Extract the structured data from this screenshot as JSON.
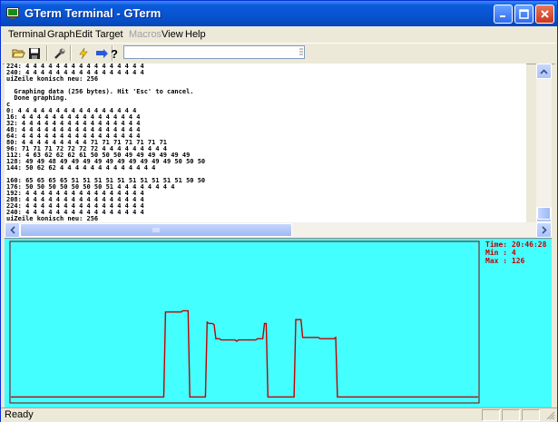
{
  "window": {
    "title": "GTerm Terminal - GTerm",
    "icon": "terminal-app-icon",
    "controls": [
      "minimize-icon",
      "maximize-icon",
      "close-icon"
    ]
  },
  "menu": [
    {
      "label": "Terminal",
      "enabled": true
    },
    {
      "label": "Graph",
      "enabled": true
    },
    {
      "label": "Edit",
      "enabled": true
    },
    {
      "label": "Target",
      "enabled": true
    },
    {
      "label": "Macros",
      "enabled": false
    },
    {
      "label": "View",
      "enabled": true
    },
    {
      "label": "Help",
      "enabled": true
    }
  ],
  "toolbar": {
    "buttons": [
      "open-folder-icon",
      "save-icon",
      "wrench-icon",
      "lightning-icon",
      "arrow-right-icon",
      "help-icon"
    ],
    "command_input": {
      "value": "",
      "placeholder": ""
    }
  },
  "terminal": {
    "lines": [
      "224: 4 4 4 4 4 4 4 4 4 4 4 4 4 4 4 4",
      "240: 4 4 4 4 4 4 4 4 4 4 4 4 4 4 4 4",
      "uiZeile konisch neu: 256",
      "",
      "  Graphing data (256 bytes). Hit 'Esc' to cancel.",
      "  Done graphing.",
      "c",
      "0: 4 4 4 4 4 4 4 4 4 4 4 4 4 4 4 4",
      "16: 4 4 4 4 4 4 4 4 4 4 4 4 4 4 4 4",
      "32: 4 4 4 4 4 4 4 4 4 4 4 4 4 4 4 4",
      "48: 4 4 4 4 4 4 4 4 4 4 4 4 4 4 4 4",
      "64: 4 4 4 4 4 4 4 4 4 4 4 4 4 4 4 4",
      "80: 4 4 4 4 4 4 4 4 4 71 71 71 71 71 71 71",
      "96: 71 71 71 72 72 72 72 4 4 4 4 4 4 4 4 4",
      "112: 4 63 62 62 62 61 50 50 50 49 49 49 49 49 49",
      "128: 49 49 48 49 49 49 49 49 49 49 49 49 49 50 50 50",
      "144: 50 62 62 4 4 4 4 4 4 4 4 4 4 4 4 4",
      "",
      "160: 65 65 65 65 51 51 51 51 51 51 51 51 51 51 50 50",
      "176: 50 50 50 50 50 50 50 51 4 4 4 4 4 4 4 4",
      "192: 4 4 4 4 4 4 4 4 4 4 4 4 4 4 4 4",
      "208: 4 4 4 4 4 4 4 4 4 4 4 4 4 4 4 4",
      "224: 4 4 4 4 4 4 4 4 4 4 4 4 4 4 4 4",
      "240: 4 4 4 4 4 4 4 4 4 4 4 4 4 4 4 4",
      "uiZeile konisch neu: 256"
    ]
  },
  "graph": {
    "time_label": "Time: 20:46:28",
    "min_label": "Min : 4",
    "max_label": "Max : 126",
    "background": "#44ffff",
    "line_color": "#c00000",
    "ylim": [
      0,
      126
    ],
    "values": [
      4,
      4,
      4,
      4,
      4,
      4,
      4,
      4,
      4,
      4,
      4,
      4,
      4,
      4,
      4,
      4,
      4,
      4,
      4,
      4,
      4,
      4,
      4,
      4,
      4,
      4,
      4,
      4,
      4,
      4,
      4,
      4,
      4,
      4,
      4,
      4,
      4,
      4,
      4,
      4,
      4,
      4,
      4,
      4,
      4,
      4,
      4,
      4,
      4,
      4,
      4,
      4,
      4,
      4,
      4,
      4,
      4,
      4,
      4,
      4,
      4,
      4,
      4,
      4,
      4,
      4,
      4,
      4,
      4,
      4,
      4,
      4,
      4,
      4,
      4,
      4,
      4,
      4,
      4,
      4,
      4,
      4,
      4,
      4,
      4,
      4,
      4,
      4,
      4,
      71,
      71,
      71,
      71,
      71,
      71,
      71,
      71,
      71,
      71,
      72,
      72,
      72,
      72,
      4,
      4,
      4,
      4,
      4,
      4,
      4,
      4,
      4,
      4,
      63,
      62,
      62,
      62,
      61,
      50,
      50,
      50,
      49,
      49,
      49,
      49,
      49,
      49,
      49,
      49,
      49,
      48,
      49,
      49,
      49,
      49,
      49,
      49,
      49,
      49,
      49,
      49,
      49,
      50,
      50,
      50,
      50,
      62,
      62,
      4,
      4,
      4,
      4,
      4,
      4,
      4,
      4,
      4,
      4,
      4,
      4,
      4,
      4,
      4,
      4,
      65,
      65,
      65,
      65,
      51,
      51,
      51,
      51,
      51,
      51,
      51,
      51,
      51,
      51,
      50,
      50,
      50,
      50,
      50,
      50,
      50,
      50,
      50,
      51,
      4,
      4,
      4,
      4,
      4,
      4,
      4,
      4,
      4,
      4,
      4,
      4,
      4,
      4,
      4,
      4,
      4,
      4,
      4,
      4,
      4,
      4,
      4,
      4,
      4,
      4,
      4,
      4,
      4,
      4,
      4,
      4,
      4,
      4,
      4,
      4,
      4,
      4,
      4,
      4,
      4,
      4,
      4,
      4,
      4,
      4,
      4,
      4,
      4,
      4,
      4,
      4,
      4,
      4,
      4,
      4,
      4,
      4,
      4,
      4,
      4,
      4,
      4,
      4,
      4,
      4,
      4,
      4,
      4,
      4,
      4,
      4,
      4,
      4,
      4,
      4,
      4,
      4,
      4,
      4,
      4,
      4
    ]
  },
  "status": {
    "text": "Ready"
  },
  "colors": {
    "titlebar": "#0a5bdc",
    "terminal_text": "#000000",
    "graph_text": "#c00000"
  }
}
